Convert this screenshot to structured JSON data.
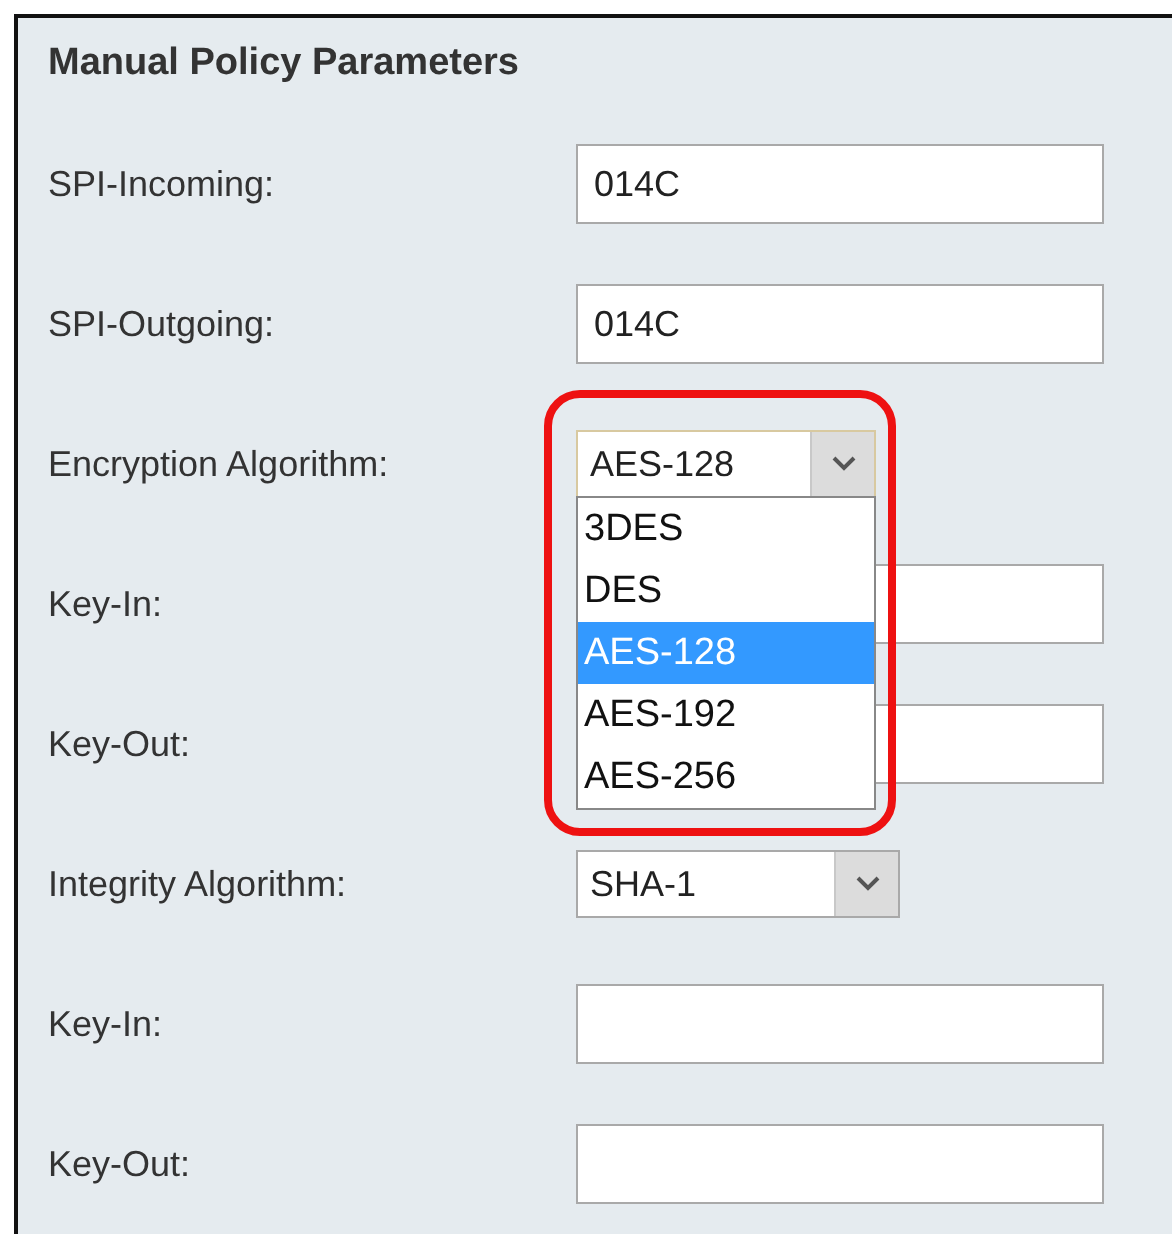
{
  "section": {
    "title": "Manual Policy Parameters"
  },
  "fields": [
    {
      "kind": "text",
      "label": "SPI-Incoming:",
      "value": "014C"
    },
    {
      "kind": "text",
      "label": "SPI-Outgoing:",
      "value": "014C"
    },
    {
      "kind": "select",
      "label": "Encryption Algorithm:",
      "value": "AES-128",
      "expanded": true,
      "highlighted": true,
      "options": [
        {
          "label": "3DES",
          "selected": false
        },
        {
          "label": "DES",
          "selected": false
        },
        {
          "label": "AES-128",
          "selected": true
        },
        {
          "label": "AES-192",
          "selected": false
        },
        {
          "label": "AES-256",
          "selected": false
        }
      ]
    },
    {
      "kind": "text",
      "label": "Key-In:"
    },
    {
      "kind": "text",
      "label": "Key-Out:"
    },
    {
      "kind": "select",
      "label": "Integrity Algorithm:",
      "value": "SHA-1",
      "expanded": false
    },
    {
      "kind": "text",
      "label": "Key-In:"
    },
    {
      "kind": "text",
      "label": "Key-Out:"
    }
  ]
}
